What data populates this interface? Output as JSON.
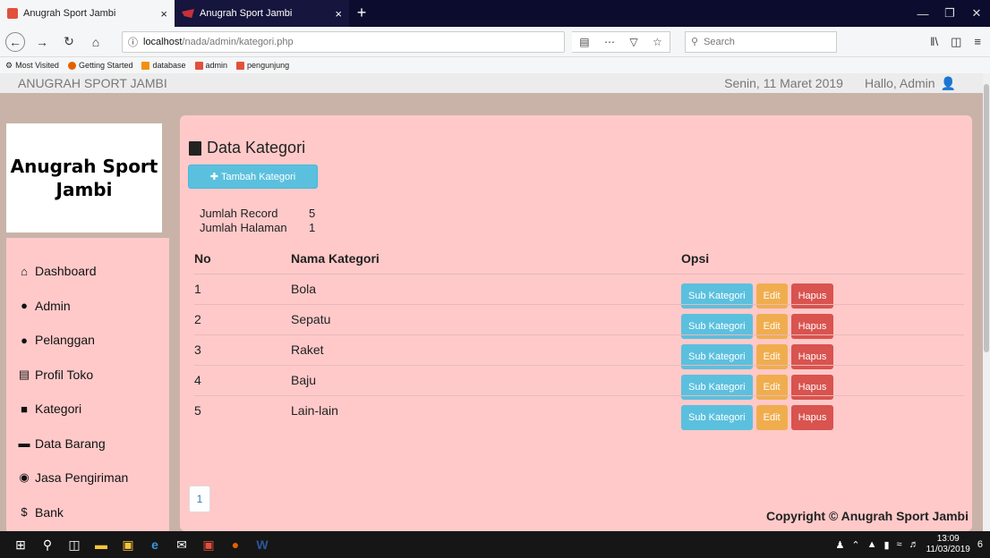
{
  "browser": {
    "tabs": [
      {
        "title": "Anugrah Sport Jambi",
        "close": "×"
      },
      {
        "title": "Anugrah Sport Jambi",
        "close": "×"
      }
    ],
    "new_tab": "+",
    "url_host": "localhost",
    "url_path": "/nada/admin/kategori.php",
    "search_placeholder": "Search",
    "bookmarks": [
      "Most Visited",
      "Getting Started",
      "database",
      "admin",
      "pengunjung"
    ]
  },
  "header": {
    "brand": "ANUGRAH SPORT JAMBI",
    "date": "Senin, 11 Maret 2019",
    "greeting": "Hallo, Admin"
  },
  "logo": {
    "line1": "Anugrah Sport",
    "line2": "Jambi"
  },
  "sidebar": {
    "items": [
      {
        "label": "Dashboard",
        "icon": "home-icon"
      },
      {
        "label": "Admin",
        "icon": "user-icon"
      },
      {
        "label": "Pelanggan",
        "icon": "user-icon"
      },
      {
        "label": "Profil Toko",
        "icon": "list-icon"
      },
      {
        "label": "Kategori",
        "icon": "book-icon"
      },
      {
        "label": "Data Barang",
        "icon": "folder-icon"
      },
      {
        "label": "Jasa Pengiriman",
        "icon": "map-marker-icon"
      },
      {
        "label": "Bank",
        "icon": "dollar-icon"
      }
    ]
  },
  "main": {
    "title": "Data Kategori",
    "add_button": "Tambah Kategori",
    "stats": {
      "records_label": "Jumlah Record",
      "records_value": "5",
      "pages_label": "Jumlah Halaman",
      "pages_value": "1"
    },
    "columns": {
      "no": "No",
      "nama": "Nama Kategori",
      "opsi": "Opsi"
    },
    "rows": [
      {
        "no": "1",
        "nama": "Bola"
      },
      {
        "no": "2",
        "nama": "Sepatu"
      },
      {
        "no": "3",
        "nama": "Raket"
      },
      {
        "no": "4",
        "nama": "Baju"
      },
      {
        "no": "5",
        "nama": "Lain-lain"
      }
    ],
    "actions": {
      "sub": "Sub Kategori",
      "edit": "Edit",
      "delete": "Hapus"
    },
    "page": "1",
    "copyright": "Copyright © Anugrah Sport Jambi"
  },
  "taskbar": {
    "time": "13:09",
    "date": "11/03/2019",
    "notifications": "6"
  },
  "colors": {
    "panel": "#ffc9c9",
    "info": "#5bc0de",
    "warning": "#f0ad4e",
    "danger": "#d9534f"
  }
}
